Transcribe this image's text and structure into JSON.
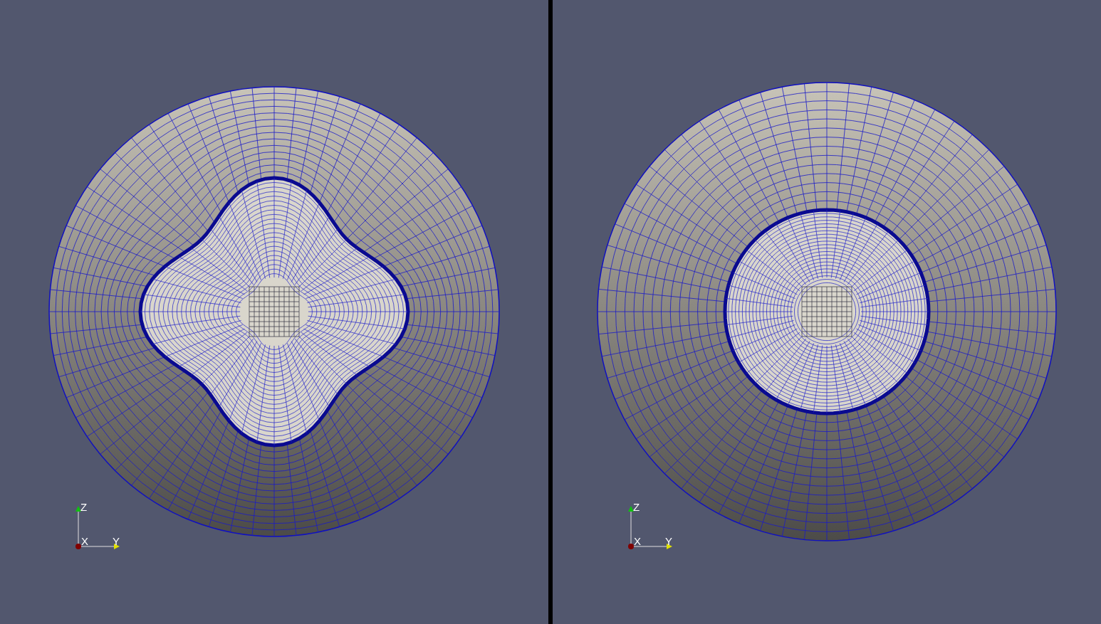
{
  "viewports": [
    {
      "mesh": {
        "kind": "clover"
      },
      "axes": {
        "z": "Z",
        "x": "X",
        "y": "Y"
      }
    },
    {
      "mesh": {
        "kind": "circle"
      },
      "axes": {
        "z": "Z",
        "x": "X",
        "y": "Y"
      }
    }
  ]
}
